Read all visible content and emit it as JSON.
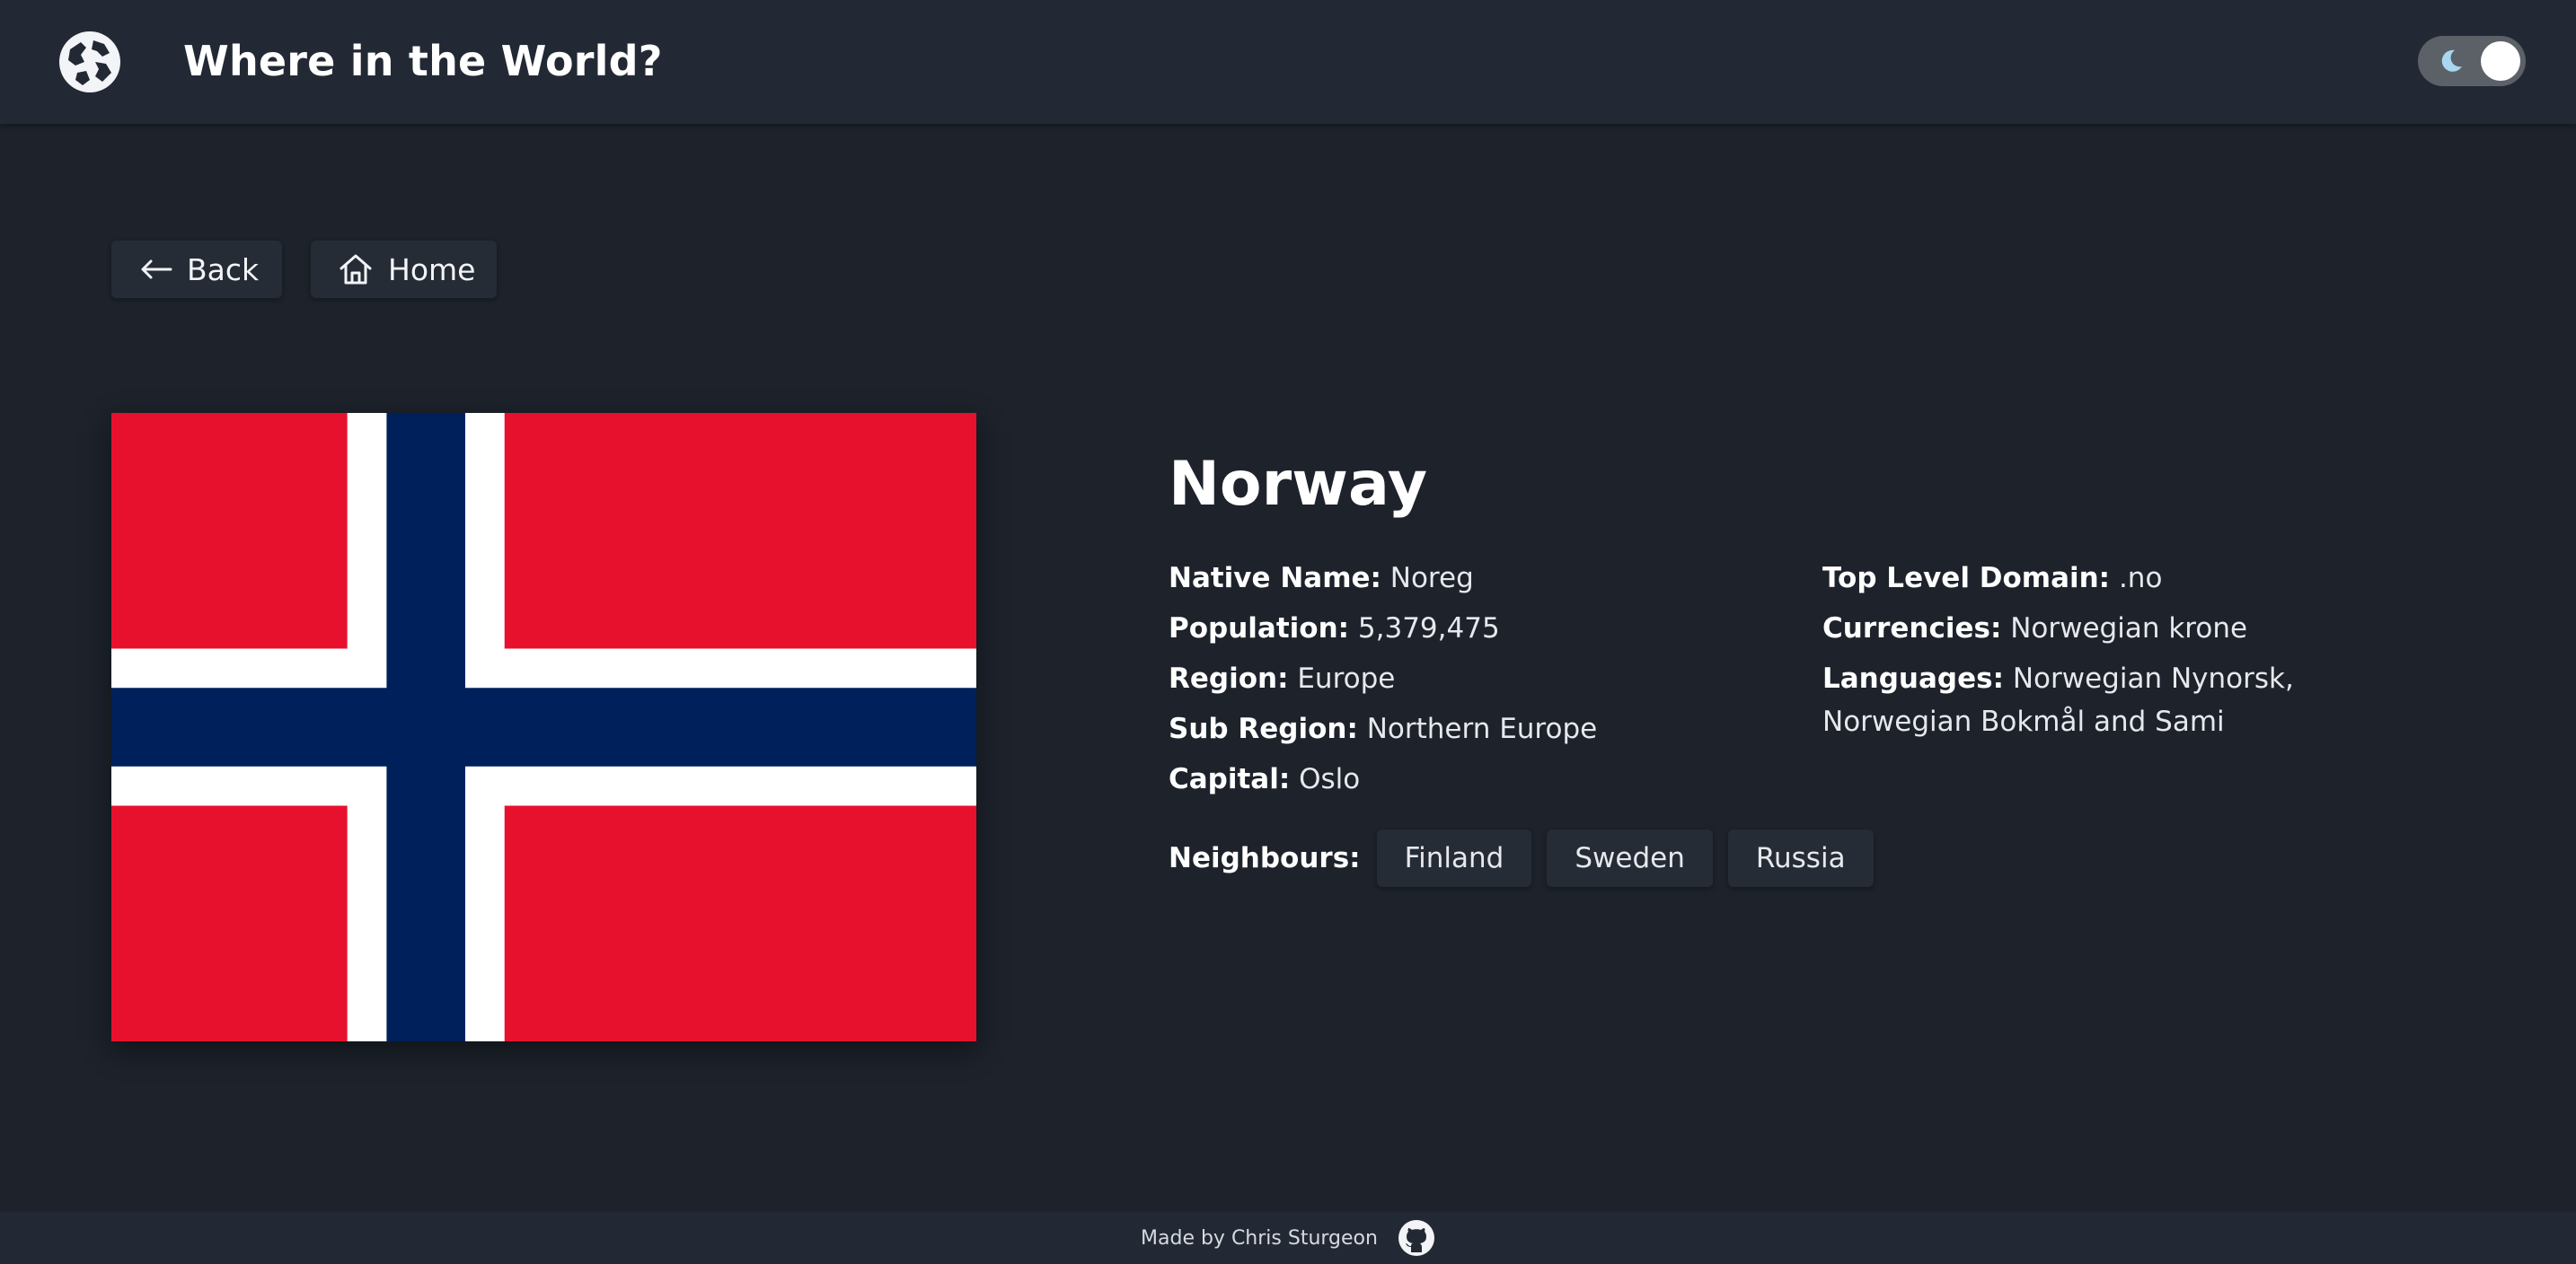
{
  "header": {
    "title": "Where in the World?",
    "logo_icon": "globe-icon",
    "theme_toggle": {
      "mode": "dark",
      "icon": "moon-icon"
    }
  },
  "nav": {
    "back_label": "Back",
    "back_icon": "arrow-left-icon",
    "home_label": "Home",
    "home_icon": "home-icon"
  },
  "country": {
    "name": "Norway",
    "flag": {
      "colors": {
        "red": "#e8112d",
        "white": "#ffffff",
        "blue": "#00205b"
      }
    },
    "left_details": [
      {
        "key": "Native Name:",
        "value": "Noreg"
      },
      {
        "key": "Population:",
        "value": "5,379,475"
      },
      {
        "key": "Region:",
        "value": "Europe"
      },
      {
        "key": "Sub Region:",
        "value": "Northern Europe"
      },
      {
        "key": "Capital:",
        "value": "Oslo"
      }
    ],
    "right_details": [
      {
        "key": "Top Level Domain:",
        "value": ".no"
      },
      {
        "key": "Currencies:",
        "value": "Norwegian krone"
      },
      {
        "key": "Languages:",
        "value": "Norwegian Nynorsk, Norwegian Bokmål and Sami"
      }
    ],
    "neighbours_label": "Neighbours:",
    "neighbours": [
      "Finland",
      "Sweden",
      "Russia"
    ]
  },
  "footer": {
    "text": "Made by Chris Sturgeon",
    "icon": "github-icon"
  },
  "colors": {
    "background": "#1d222b",
    "surface": "#232934",
    "element": "#262c36",
    "text": "#f2f4f7"
  }
}
